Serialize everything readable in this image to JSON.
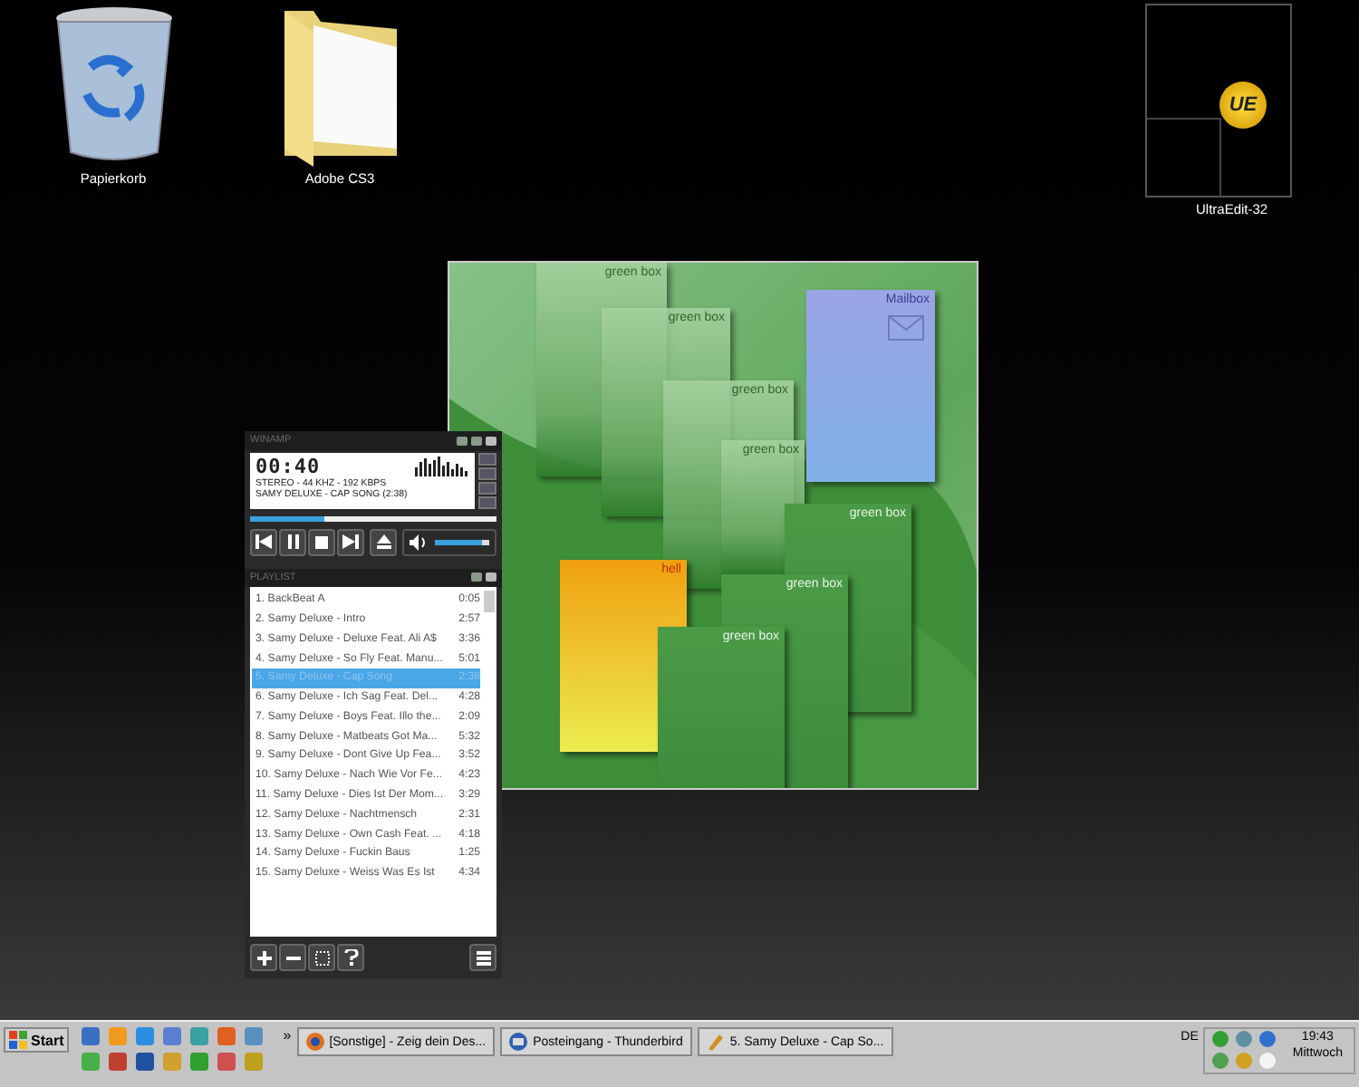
{
  "desktop_icons": [
    {
      "kind": "trash",
      "label": "Papierkorb"
    },
    {
      "kind": "folder",
      "label": "Adobe CS3"
    }
  ],
  "ultraedit": {
    "label": "UltraEdit-32",
    "logo": "UE"
  },
  "widget": {
    "boxes": [
      {
        "kind": "light",
        "label": "green box"
      },
      {
        "kind": "light",
        "label": "green box"
      },
      {
        "kind": "light",
        "label": "green box"
      },
      {
        "kind": "light",
        "label": "green box"
      },
      {
        "kind": "mail",
        "label": "Mailbox"
      },
      {
        "kind": "green",
        "label": "green box"
      },
      {
        "kind": "green",
        "label": "green box"
      },
      {
        "kind": "orange",
        "label": "hell"
      },
      {
        "kind": "green",
        "label": "green box"
      }
    ]
  },
  "player": {
    "title": "WINAMP",
    "time": "00:40",
    "info": "STEREO - 44 KHZ - 192 KBPS",
    "track": "SAMY DELUXE - CAP SONG (2:38)",
    "progress": {
      "level": 0.3
    },
    "volume": {
      "level": 0.85
    }
  },
  "playlist": {
    "title": "PLAYLIST",
    "items": [
      {
        "title": "1. BackBeat A",
        "duration": "0:05",
        "selected": false
      },
      {
        "title": "2. Samy Deluxe - Intro",
        "duration": "2:57",
        "selected": false
      },
      {
        "title": "3. Samy Deluxe - Deluxe Feat. Ali A$",
        "duration": "3:36",
        "selected": false
      },
      {
        "title": "4. Samy Deluxe - So Fly Feat. Manu...",
        "duration": "5:01",
        "selected": false
      },
      {
        "title": "5. Samy Deluxe - Cap Song",
        "duration": "2:38",
        "selected": true
      },
      {
        "title": "6. Samy Deluxe - Ich Sag Feat. Del...",
        "duration": "4:28",
        "selected": false
      },
      {
        "title": "7. Samy Deluxe - Boys Feat. Illo the...",
        "duration": "2:09",
        "selected": false
      },
      {
        "title": "8. Samy Deluxe - Matbeats Got Ma...",
        "duration": "5:32",
        "selected": false
      },
      {
        "title": "9. Samy Deluxe - Dont Give Up Fea...",
        "duration": "3:52",
        "selected": false
      },
      {
        "title": "10. Samy Deluxe - Nach Wie Vor Fe...",
        "duration": "4:23",
        "selected": false
      },
      {
        "title": "11. Samy Deluxe - Dies Ist Der Mom...",
        "duration": "3:29",
        "selected": false
      },
      {
        "title": "12. Samy Deluxe - Nachtmensch",
        "duration": "2:31",
        "selected": false
      },
      {
        "title": "13. Samy Deluxe - Own Cash Feat. ...",
        "duration": "4:18",
        "selected": false
      },
      {
        "title": "14. Samy Deluxe - Fuckin Baus",
        "duration": "1:25",
        "selected": false
      },
      {
        "title": "15. Samy Deluxe - Weiss Was Es Ist",
        "duration": "4:34",
        "selected": false
      }
    ]
  },
  "taskbar": {
    "start": "Start",
    "more": "»",
    "tasks": [
      {
        "label": "[Sonstige] - Zeig dein Des...",
        "kind": "browser"
      },
      {
        "label": "Posteingang - Thunderbird",
        "kind": "mail"
      },
      {
        "label": "5. Samy Deluxe - Cap So...",
        "kind": "player"
      }
    ],
    "language": "DE",
    "time": "19:43",
    "day": "Mittwoch"
  }
}
